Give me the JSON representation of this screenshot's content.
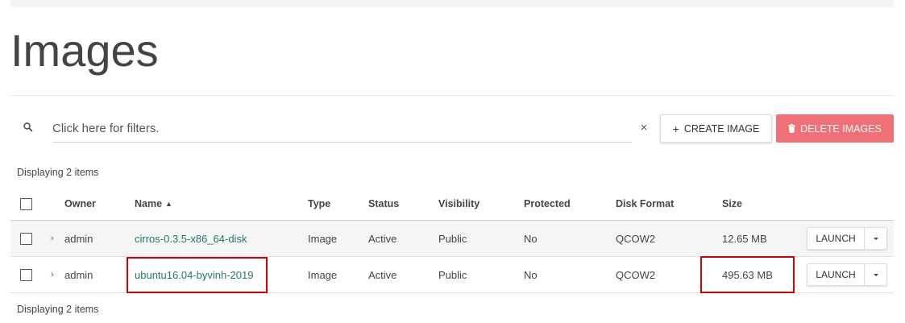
{
  "page": {
    "title": "Images"
  },
  "filter": {
    "placeholder": "Click here for filters.",
    "clear_symbol": "×",
    "search_icon": "search-icon"
  },
  "actions": {
    "create_label": "CREATE IMAGE",
    "create_icon": "+",
    "delete_label": "DELETE IMAGES",
    "delete_color": "#f07076"
  },
  "summary": {
    "top": "Displaying 2 items",
    "bottom": "Displaying 2 items"
  },
  "table": {
    "columns": {
      "owner": "Owner",
      "name": "Name",
      "type": "Type",
      "status": "Status",
      "visibility": "Visibility",
      "protected": "Protected",
      "disk_format": "Disk Format",
      "size": "Size"
    },
    "sort_indicator": "▲",
    "expand_symbol": "›",
    "launch_label": "LAUNCH",
    "rows": [
      {
        "owner": "admin",
        "name": "cirros-0.3.5-x86_64-disk",
        "type": "Image",
        "status": "Active",
        "visibility": "Public",
        "protected": "No",
        "disk_format": "QCOW2",
        "size": "12.65 MB"
      },
      {
        "owner": "admin",
        "name": "ubuntu16.04-byvinh-2019",
        "type": "Image",
        "status": "Active",
        "visibility": "Public",
        "protected": "No",
        "disk_format": "QCOW2",
        "size": "495.63 MB"
      }
    ]
  },
  "colors": {
    "link": "#1f7a6a",
    "highlight": "#d60000"
  }
}
